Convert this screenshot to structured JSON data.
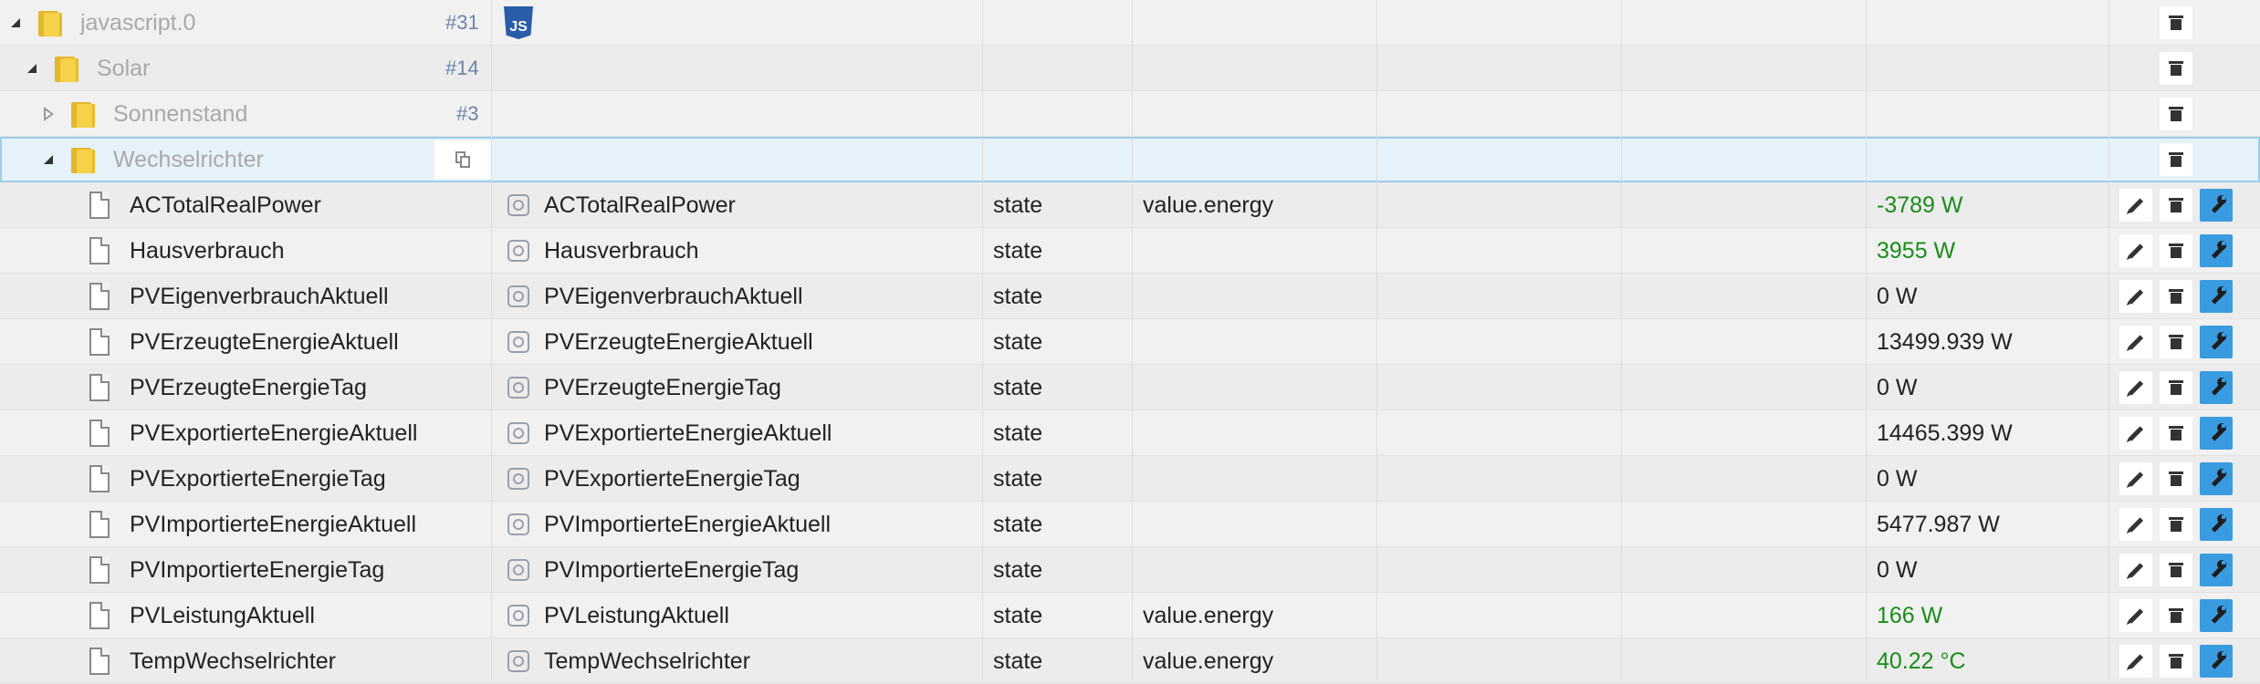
{
  "colors": {
    "green_value": "#1a8c1a",
    "folder_text": "#a9a9a9",
    "count_text": "#6d84a8",
    "selected_row_bg": "#e6f2fa",
    "wrench_button_bg": "#3a9ce0"
  },
  "folders": [
    {
      "name": "javascript.0",
      "count": "#31",
      "badge": "JS",
      "icon": "folder-icon"
    },
    {
      "name": "Solar",
      "count": "#14",
      "icon": "folder-icon"
    },
    {
      "name": "Sonnenstand",
      "count": "#3",
      "icon": "folder-icon"
    },
    {
      "name": "Wechselrichter",
      "icon": "folder-icon"
    }
  ],
  "states": [
    {
      "id": "ACTotalRealPower",
      "name": "ACTotalRealPower",
      "type": "state",
      "role": "value.energy",
      "value": "-3789 W",
      "highlight": true
    },
    {
      "id": "Hausverbrauch",
      "name": "Hausverbrauch",
      "type": "state",
      "role": "",
      "value": "3955 W",
      "highlight": true
    },
    {
      "id": "PVEigenverbrauchAktuell",
      "name": "PVEigenverbrauchAktuell",
      "type": "state",
      "role": "",
      "value": "0 W",
      "highlight": false
    },
    {
      "id": "PVErzeugteEnergieAktuell",
      "name": "PVErzeugteEnergieAktuell",
      "type": "state",
      "role": "",
      "value": "13499.939 W",
      "highlight": false
    },
    {
      "id": "PVErzeugteEnergieTag",
      "name": "PVErzeugteEnergieTag",
      "type": "state",
      "role": "",
      "value": "0 W",
      "highlight": false
    },
    {
      "id": "PVExportierteEnergieAktuell",
      "name": "PVExportierteEnergieAktuell",
      "type": "state",
      "role": "",
      "value": "14465.399 W",
      "highlight": false
    },
    {
      "id": "PVExportierteEnergieTag",
      "name": "PVExportierteEnergieTag",
      "type": "state",
      "role": "",
      "value": "0 W",
      "highlight": false
    },
    {
      "id": "PVImportierteEnergieAktuell",
      "name": "PVImportierteEnergieAktuell",
      "type": "state",
      "role": "",
      "value": "5477.987 W",
      "highlight": false
    },
    {
      "id": "PVImportierteEnergieTag",
      "name": "PVImportierteEnergieTag",
      "type": "state",
      "role": "",
      "value": "0 W",
      "highlight": false
    },
    {
      "id": "PVLeistungAktuell",
      "name": "PVLeistungAktuell",
      "type": "state",
      "role": "value.energy",
      "value": "166 W",
      "highlight": true
    },
    {
      "id": "TempWechselrichter",
      "name": "TempWechselrichter",
      "type": "state",
      "role": "value.energy",
      "value": "40.22 °C",
      "highlight": true
    }
  ]
}
